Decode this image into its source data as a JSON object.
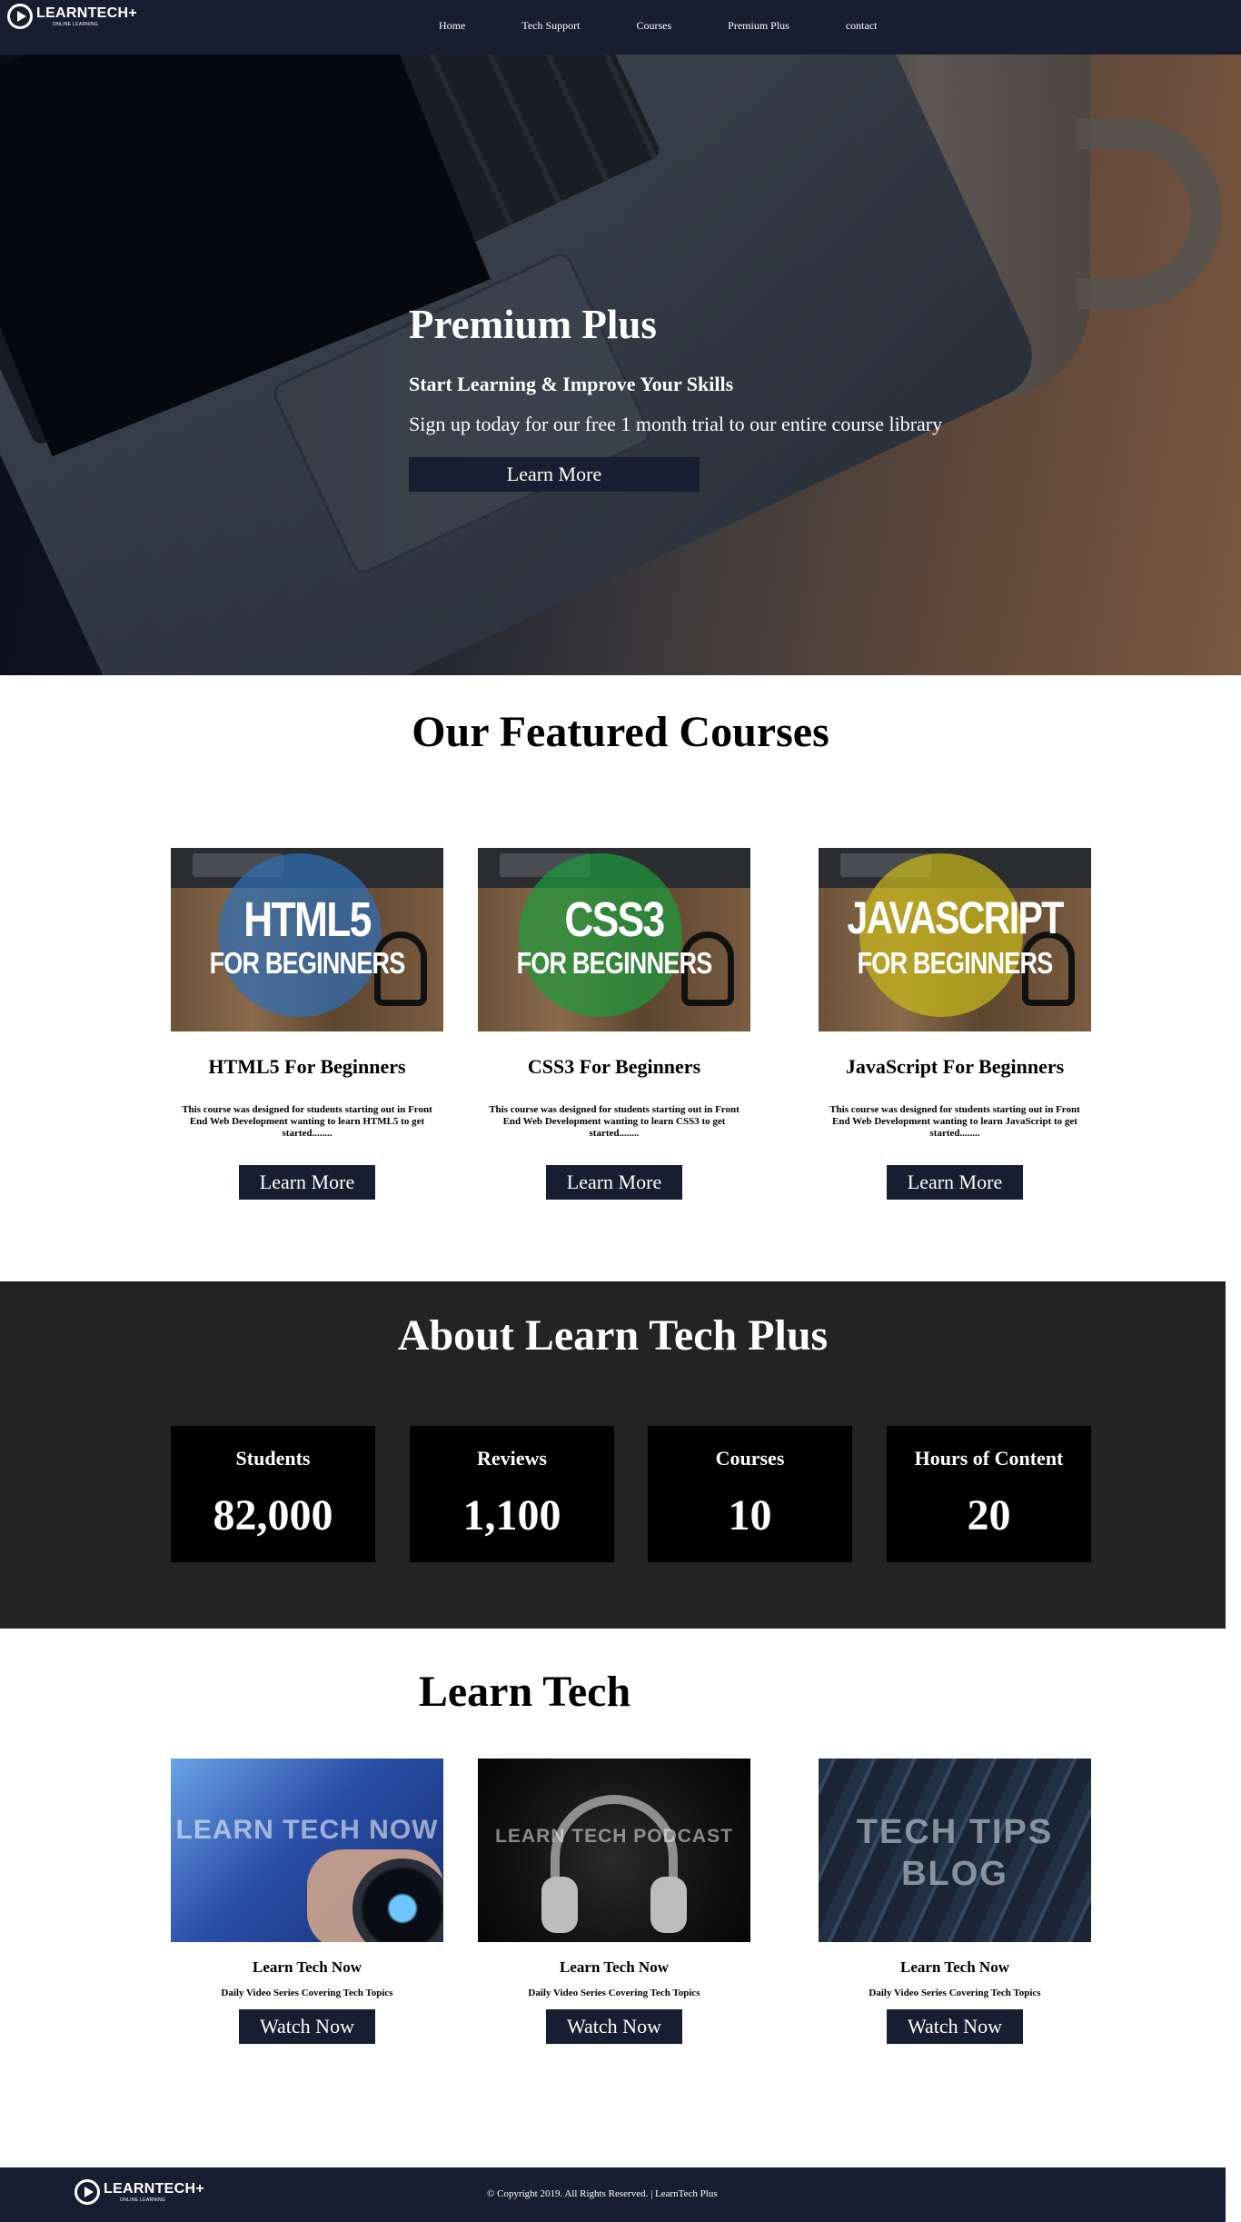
{
  "brand": {
    "name": "LEARNTECH+",
    "tagline": "ONLINE LEARNING"
  },
  "nav": {
    "links": [
      {
        "label": "Home"
      },
      {
        "label": "Tech Support"
      },
      {
        "label": "Courses"
      },
      {
        "label": "Premium Plus"
      },
      {
        "label": "contact"
      }
    ]
  },
  "hero": {
    "title": "Premium Plus",
    "subtitle": "Start Learning & Improve Your Skills",
    "text": "Sign up today for our free 1 month trial to our entire course library",
    "button_label": "Learn More"
  },
  "featured": {
    "title": "Our Featured Courses",
    "courses": [
      {
        "image_big": "HTML5",
        "image_small": "FOR BEGINNERS",
        "circle_color": "#2f6fb6",
        "title": "HTML5 For Beginners",
        "description": "This course was designed for students starting out in Front End Web Development wanting to learn HTML5 to get started........",
        "button_label": "Learn More"
      },
      {
        "image_big": "CSS3",
        "image_small": "FOR BEGINNERS",
        "circle_color": "#1f9a3c",
        "title": "CSS3 For Beginners",
        "description": "This course was designed for students starting out in Front End Web Development wanting to learn CSS3 to get started........",
        "button_label": "Learn More"
      },
      {
        "image_big": "JAVASCRIPT",
        "image_small": "FOR BEGINNERS",
        "circle_color": "#c9b91a",
        "title": "JavaScript For Beginners",
        "description": "This course was designed for students starting out in Front End Web Development wanting to learn JavaScript to get started........",
        "button_label": "Learn More"
      }
    ]
  },
  "about": {
    "title": "About Learn Tech Plus",
    "stats": [
      {
        "label": "Students",
        "value": "82,000"
      },
      {
        "label": "Reviews",
        "value": "1,100"
      },
      {
        "label": "Courses",
        "value": "10"
      },
      {
        "label": "Hours of Content",
        "value": "20"
      }
    ]
  },
  "learn_tech": {
    "title": "Learn Tech",
    "items": [
      {
        "image_text": "LEARN TECH NOW",
        "title": "Learn Tech Now",
        "subtitle": "Daily Video Series Covering Tech Topics",
        "button_label": "Watch Now"
      },
      {
        "image_text": "LEARN TECH PODCAST",
        "title": "Learn Tech Now",
        "subtitle": "Daily Video Series Covering Tech Topics",
        "button_label": "Watch Now"
      },
      {
        "image_text_line1": "TECH TIPS",
        "image_text_line2": "BLOG",
        "title": "Learn Tech Now",
        "subtitle": "Daily Video Series Covering Tech Topics",
        "button_label": "Watch Now"
      }
    ]
  },
  "footer": {
    "copyright": "© Copyright 2019. All Rights Reserved. | LearnTech Plus"
  },
  "colors": {
    "navy": "#181e31",
    "about_bg": "#232323",
    "stat_bg": "#000000"
  }
}
